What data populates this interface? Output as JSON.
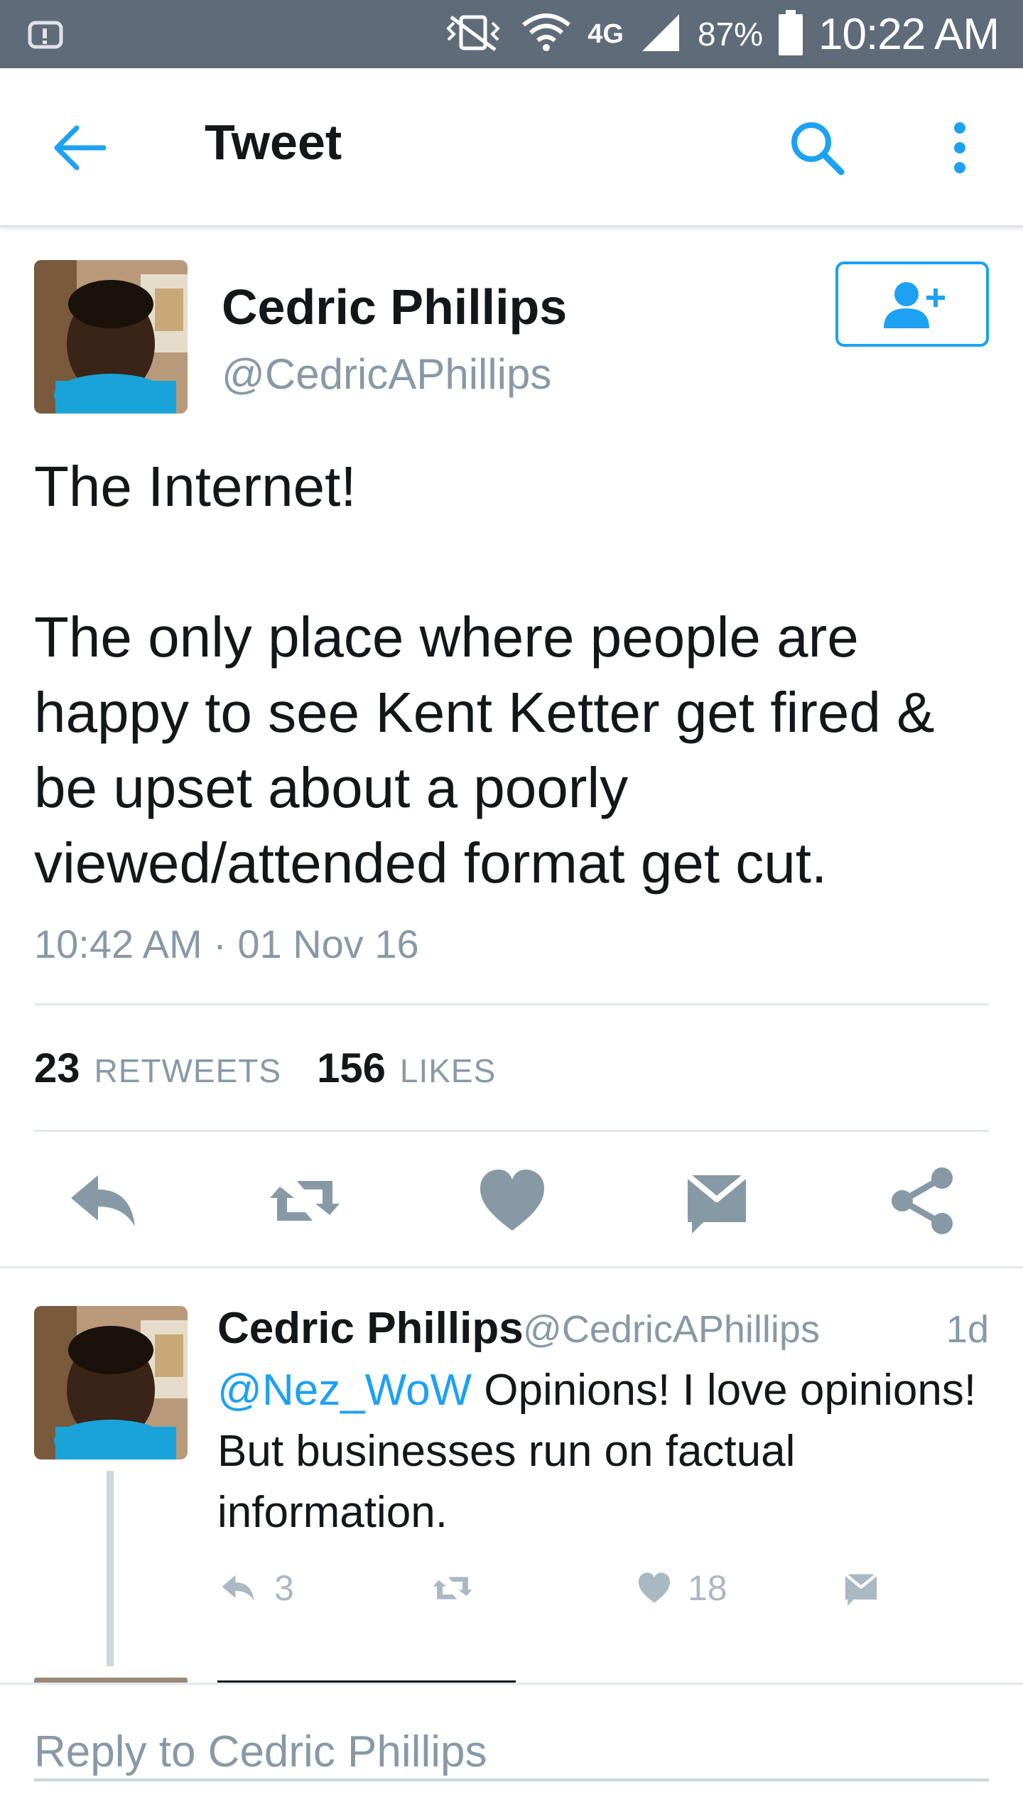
{
  "status_bar": {
    "battery": "87%",
    "time": "10:22 AM",
    "network": "4G"
  },
  "toolbar": {
    "title": "Tweet"
  },
  "tweet": {
    "author_name": "Cedric Phillips",
    "author_handle": "@CedricAPhillips",
    "text": "The Internet!\n\nThe only place where people are happy to see Kent Ketter get fired & be upset about a poorly viewed/attended format get cut.",
    "timestamp": "10:42 AM · 01 Nov 16",
    "retweets_count": "23",
    "retweets_label": "RETWEETS",
    "likes_count": "156",
    "likes_label": "LIKES"
  },
  "reply": {
    "author_name": "Cedric Phillips",
    "author_handle": "@CedricAPhillips",
    "age": "1d",
    "mention": "@Nez_WoW",
    "text": " Opinions! I love opinions! But businesses run on factual information.",
    "reply_count": "3",
    "like_count": "18"
  },
  "reply_bar": {
    "placeholder": "Reply to Cedric Phillips"
  },
  "colors": {
    "accent": "#1da1f2",
    "status_bar": "#5f6b78",
    "muted": "#8899a6",
    "action_icon": "#8899a6"
  },
  "icons": [
    "alarm-icon",
    "vibrate-icon",
    "wifi-icon",
    "signal-icon",
    "battery-icon",
    "back-arrow-icon",
    "search-icon",
    "more-vert-icon",
    "follow-icon",
    "reply-icon",
    "retweet-icon",
    "heart-icon",
    "message-icon",
    "share-icon"
  ]
}
